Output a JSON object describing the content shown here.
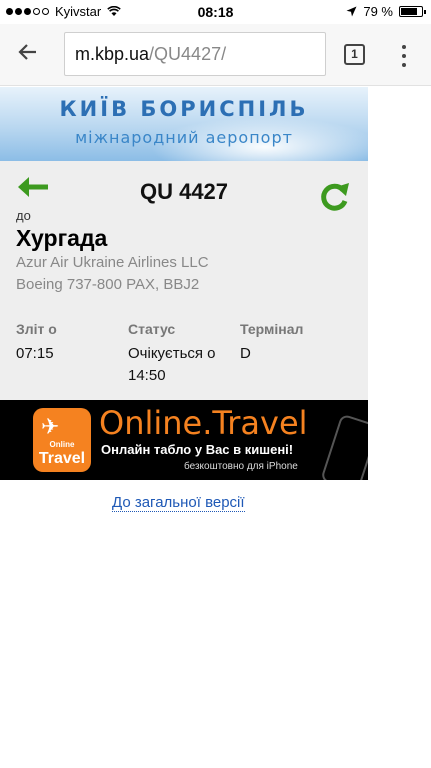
{
  "status_bar": {
    "carrier": "Kyivstar",
    "time": "08:18",
    "battery": "79 %",
    "battery_level": 0.79
  },
  "browser": {
    "url_host": "m.kbp.ua",
    "url_path": "/QU4427/",
    "tab_count": "1"
  },
  "banner": {
    "title": "КИЇВ БОРИСПІЛЬ",
    "subtitle": "міжнародний аеропорт"
  },
  "flight": {
    "number": "QU 4427",
    "to_label": "до",
    "destination": "Хургада",
    "airline": "Azur Air Ukraine Airlines LLC",
    "aircraft": "Boeing 737-800 PAX, BBJ2",
    "departure_label": "Зліт о",
    "departure_time": "07:15",
    "status_label": "Статус",
    "status_value": "Очікується о",
    "status_time": "14:50",
    "terminal_label": "Термінал",
    "terminal_value": "D"
  },
  "ad": {
    "logo_top": "Online",
    "logo_bottom": "Travel",
    "title": "Online.Travel",
    "tagline": "Онлайн табло у Вас в кишені!",
    "subline": "безкоштовно для iPhone"
  },
  "links": {
    "full_version": "До загальної версії"
  },
  "colors": {
    "accent_green": "#3d9a1f",
    "link_blue": "#1f59b6",
    "ad_orange": "#f58220"
  }
}
